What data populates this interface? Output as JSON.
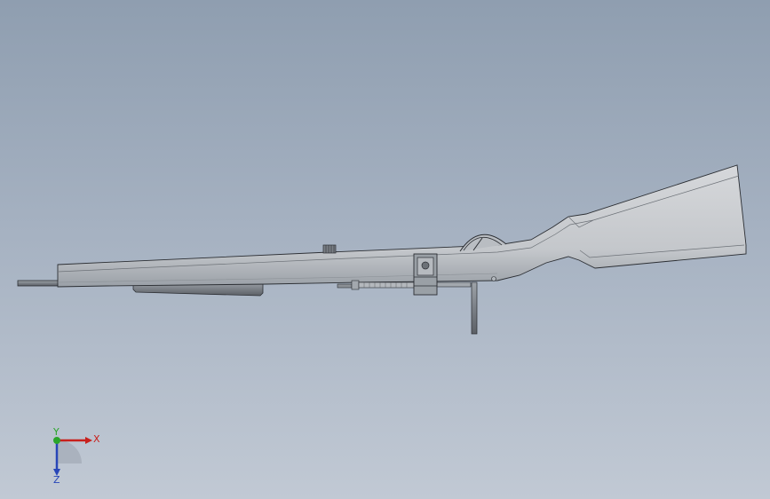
{
  "viewport": {
    "model_name": "rifle-assembly"
  },
  "triad": {
    "x_label": "X",
    "y_label": "Y",
    "z_label": "Z",
    "colors": {
      "x": "#c8201c",
      "y": "#2aa52a",
      "z": "#2846b8"
    }
  },
  "colors": {
    "background_top": "#8f9eb0",
    "background_bottom": "#c1c9d4",
    "body_light": "#d2d4d7",
    "body_shade": "#9da2a8",
    "edge": "#2b2e33"
  }
}
